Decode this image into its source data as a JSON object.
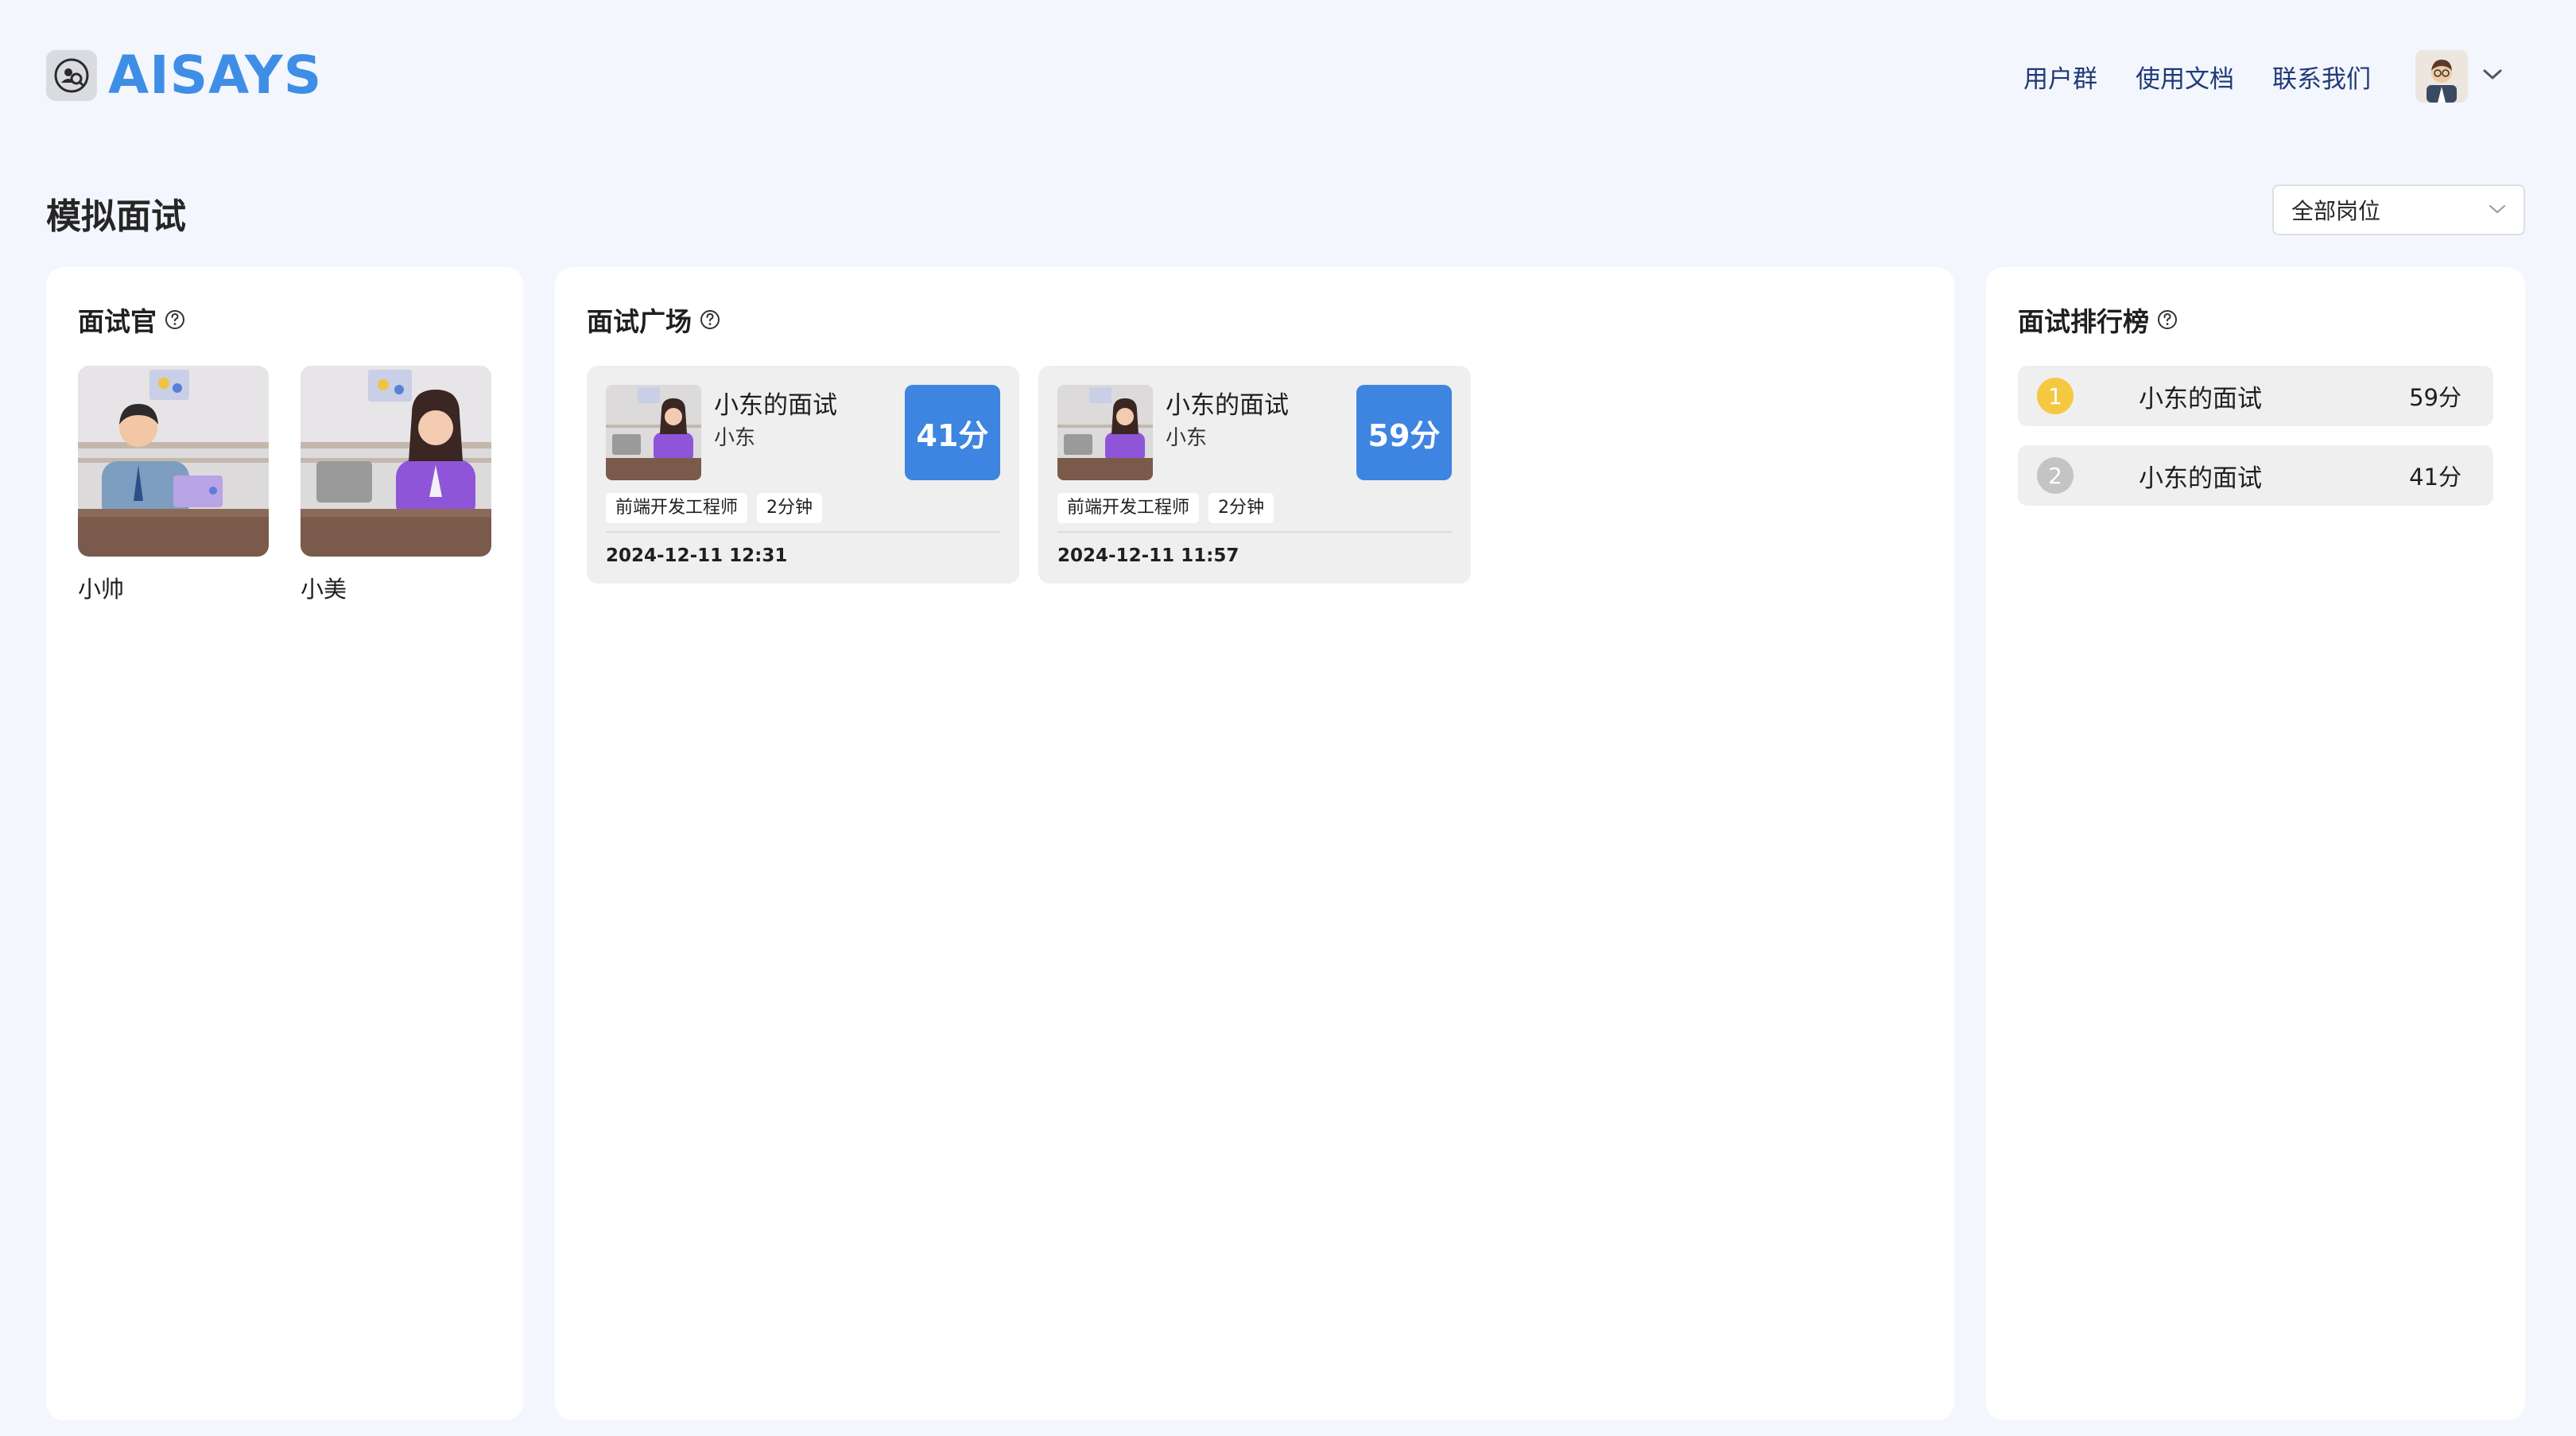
{
  "brand": {
    "name": "AISAYS",
    "color": "#3f8ee6",
    "logo_icon": "interview-logo-icon"
  },
  "nav": {
    "links": [
      "用户群",
      "使用文档",
      "联系我们"
    ]
  },
  "page": {
    "title": "模拟面试"
  },
  "filter": {
    "value": "全部岗位"
  },
  "interviewers_panel": {
    "title": "面试官",
    "items": [
      {
        "name": "小帅"
      },
      {
        "name": "小美"
      }
    ]
  },
  "plaza_panel": {
    "title": "面试广场",
    "cards": [
      {
        "title": "小东的面试",
        "user": "小东",
        "score": "41分",
        "tags": [
          "前端开发工程师",
          "2分钟"
        ],
        "time": "2024-12-11 12:31"
      },
      {
        "title": "小东的面试",
        "user": "小东",
        "score": "59分",
        "tags": [
          "前端开发工程师",
          "2分钟"
        ],
        "time": "2024-12-11 11:57"
      }
    ]
  },
  "ranking_panel": {
    "title": "面试排行榜",
    "rows": [
      {
        "rank": "1",
        "name": "小东的面试",
        "score": "59分",
        "badge_color": "#f5c842"
      },
      {
        "rank": "2",
        "name": "小东的面试",
        "score": "41分",
        "badge_color": "#c4c4c4"
      }
    ]
  },
  "colors": {
    "accent": "#3d85e0",
    "page_bg": "#f3f6fc",
    "nav_text": "#1f3a78"
  }
}
